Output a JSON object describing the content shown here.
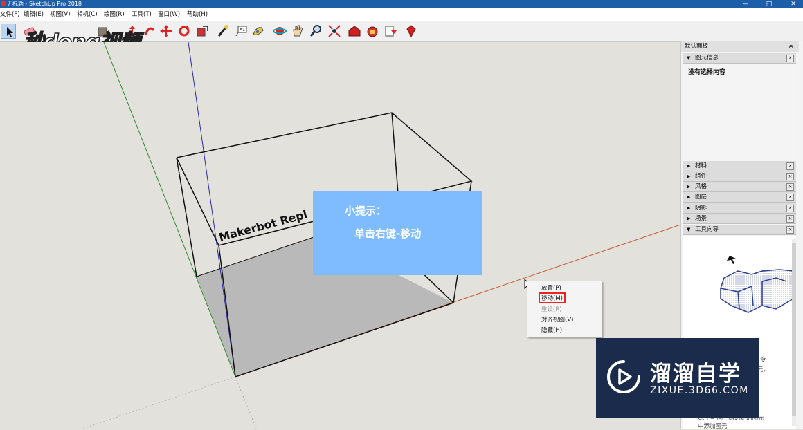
{
  "window": {
    "title": "无标题 - SketchUp Pro 2018",
    "minimize": "—",
    "maximize": "□",
    "close": "✕"
  },
  "menu": {
    "items": [
      "文件(F)",
      "编辑(E)",
      "视图(V)",
      "相机(C)",
      "绘图(R)",
      "工具(T)",
      "窗口(W)",
      "帮助(H)"
    ]
  },
  "toolbar": {
    "tools": [
      "select-icon",
      "eraser-icon",
      "paint-bucket-icon",
      "line-icon",
      "push-pull-icon",
      "follow-me-icon",
      "move-icon",
      "rotate-icon",
      "scale-icon",
      "tape-measure-icon",
      "text-icon",
      "paint-icon",
      "orbit-icon",
      "pan-icon",
      "zoom-icon",
      "zoom-extents-icon",
      "warehouse-icon",
      "extension-warehouse-icon",
      "send-to-layout-icon",
      "ruby-icon"
    ]
  },
  "watermark": {
    "logo_text": "秒dong视频"
  },
  "viewport": {
    "model_text": "Makerbot Repl",
    "tip": {
      "title": "小提示：",
      "body": "单击右键-移动"
    },
    "context_menu": {
      "items": [
        {
          "label": "放置(P)",
          "state": "normal"
        },
        {
          "label": "移动(M)",
          "state": "highlighted"
        },
        {
          "label": "重设(R)",
          "state": "disabled"
        },
        {
          "label": "对齐视图(V)",
          "state": "normal"
        },
        {
          "label": "隐藏(H)",
          "state": "normal"
        }
      ]
    }
  },
  "tray": {
    "title": "默认面板",
    "pin": "⊕",
    "entity_info": {
      "label": "图元信息",
      "empty_text": "没有选择内容"
    },
    "panels": [
      "材料",
      "组件",
      "风格",
      "图层",
      "阴影",
      "场景",
      "工具向导"
    ],
    "instructor": {
      "text1": "令",
      "text2": "元。",
      "text3": "Ctrl = 向一组选定的图元",
      "text4": "中添加图元"
    }
  },
  "brand": {
    "name": "溜溜自学",
    "url": "ZIXUE.3D66.COM"
  }
}
